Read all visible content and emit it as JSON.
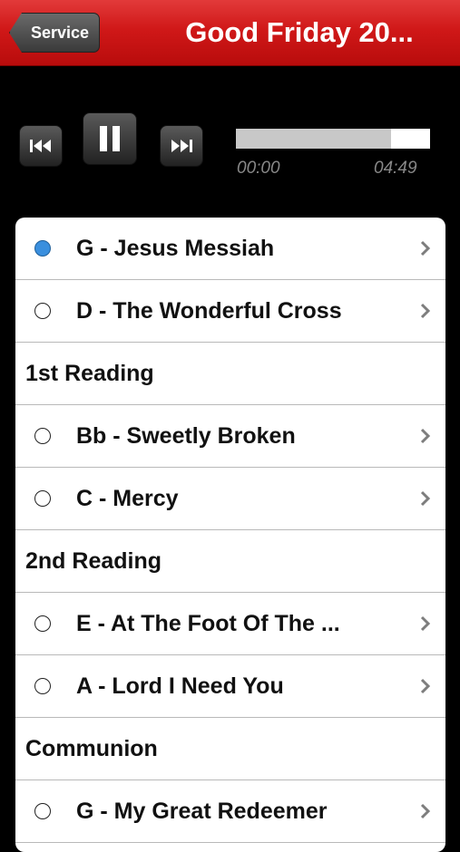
{
  "navbar": {
    "back_label": "Service",
    "title": "Good Friday 20..."
  },
  "player": {
    "elapsed": "00:00",
    "duration": "04:49",
    "progress_fraction": 0.8,
    "state": "playing"
  },
  "list": [
    {
      "type": "song",
      "label": "G - Jesus Messiah",
      "selected": true
    },
    {
      "type": "song",
      "label": "D - The Wonderful Cross",
      "selected": false
    },
    {
      "type": "header",
      "label": "1st Reading"
    },
    {
      "type": "song",
      "label": "Bb - Sweetly Broken",
      "selected": false
    },
    {
      "type": "song",
      "label": "C - Mercy",
      "selected": false
    },
    {
      "type": "header",
      "label": "2nd Reading"
    },
    {
      "type": "song",
      "label": "E - At The Foot Of The ...",
      "selected": false
    },
    {
      "type": "song",
      "label": "A - Lord I Need You",
      "selected": false
    },
    {
      "type": "header",
      "label": "Communion"
    },
    {
      "type": "song",
      "label": "G - My Great Redeemer",
      "selected": false
    }
  ],
  "colors": {
    "nav_red": "#d01818",
    "selected_blue": "#3a8fde",
    "background": "#000000"
  }
}
